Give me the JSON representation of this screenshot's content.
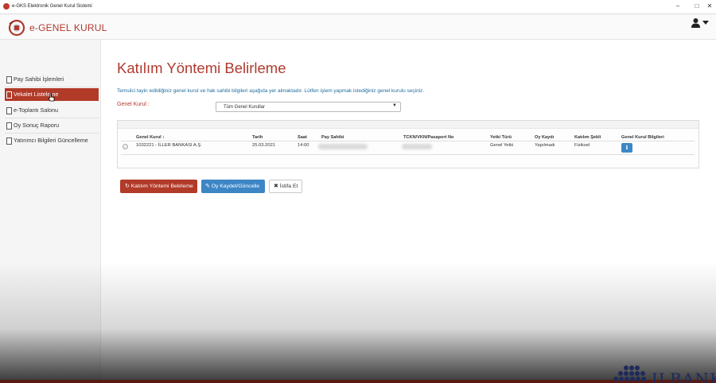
{
  "window": {
    "title": "e-GKS Elektronik Genel Kurul Sistemi"
  },
  "header": {
    "logo_text": "e-GENEL KURUL"
  },
  "sidebar": {
    "items": [
      {
        "label": "Pay Sahibi İşlemleri",
        "active": false
      },
      {
        "label": "Vekalet Listeleme",
        "active": true
      },
      {
        "label": "e-Toplantı Salonu",
        "active": false
      },
      {
        "label": "Oy Sonuç Raporu",
        "active": false
      },
      {
        "label": "Yatırımcı Bilgileri Güncelleme",
        "active": false
      }
    ]
  },
  "main": {
    "title": "Katılım Yöntemi Belirleme",
    "description": "Temsilci tayin edildiğiniz genel kurul ve hak sahibi bilgileri aşağıda yer almaktadır. Lütfen işlem yapmak istediğiniz genel kurulu seçiniz.",
    "filter": {
      "label": "Genel Kurul :",
      "selected": "Tüm Genel Kurullar"
    },
    "table": {
      "columns": [
        "Genel Kurul ↕",
        "Tarih",
        "Saat",
        "Pay Sahibi",
        "TCKN/VKN/Pasaport No",
        "Yetki Türü",
        "Oy Kaydı",
        "Katılım Şekli",
        "Genel Kurul Bilgileri"
      ],
      "rows": [
        {
          "genel_kurul": "1032221 - İLLER BANKASI A.Ş.",
          "tarih": "25.03.2021",
          "saat": "14:00",
          "pay_sahibi": "",
          "tckn": "",
          "yetki_turu": "Genel Yetki",
          "oy_kaydi": "Yapılmadı",
          "katilim_sekli": "Fiziksel",
          "info_glyph": "i"
        }
      ]
    },
    "buttons": {
      "katilim_label": "Katılım Yöntemi Belirleme",
      "oy_label": "Oy Kaydet/Güncelle",
      "istifa_label": "İstifa Et"
    }
  },
  "icons": {
    "katilim_glyph": "↻",
    "oy_glyph": "✎",
    "istifa_glyph": "✖",
    "maximize_glyph": "□",
    "close_glyph": "✕"
  },
  "colors": {
    "brand": "#b03a2e",
    "active": "#b23a28",
    "primary_button": "#3d86c6",
    "link_text": "#1f6d9e"
  },
  "bank_logo": {
    "text": "ILBANK"
  }
}
